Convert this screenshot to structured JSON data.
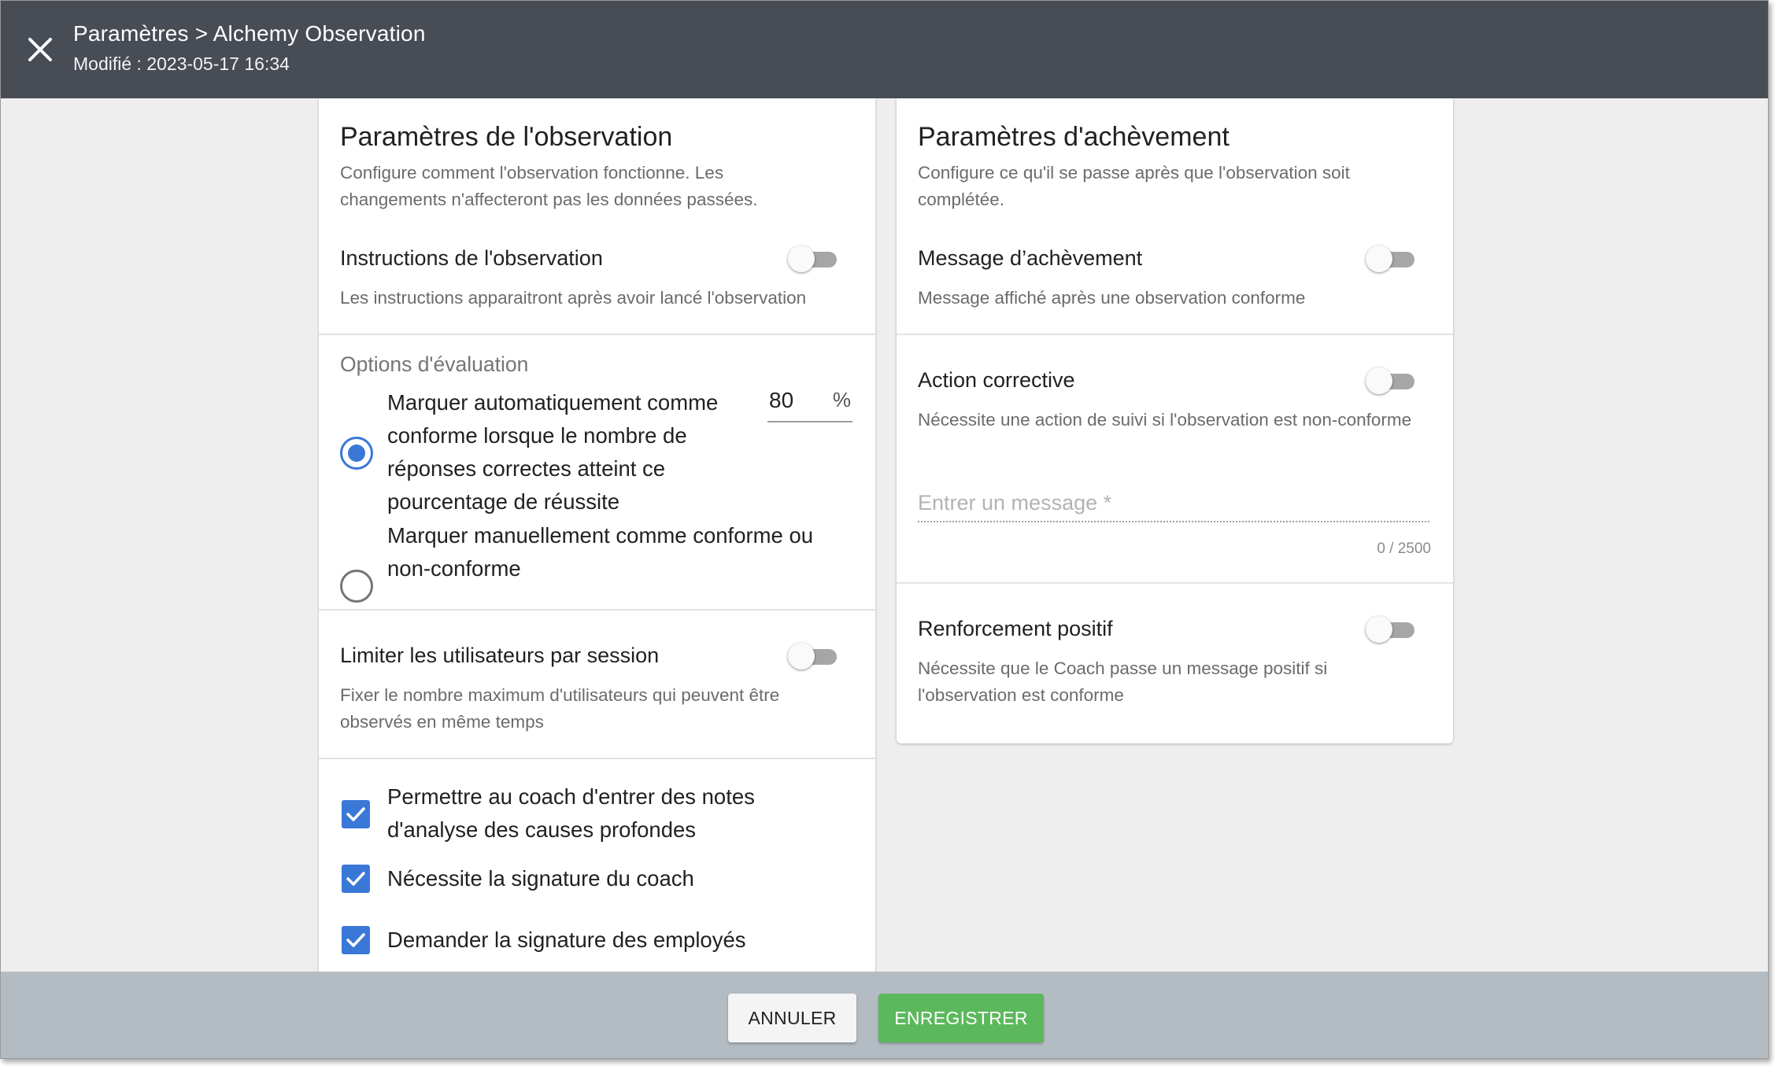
{
  "header": {
    "title": "Paramètres > Alchemy Observation",
    "modified": "Modifié : 2023-05-17 16:34"
  },
  "observation": {
    "title": "Paramètres de l'observation",
    "description": "Configure comment l'observation fonctionne. Les changements n'affecteront pas les données passées.",
    "instructions": {
      "label": "Instructions de l'observation",
      "description": "Les instructions apparaitront après avoir lancé l'observation",
      "enabled": false
    },
    "evaluation": {
      "title": "Options d'évaluation",
      "auto_label": "Marquer automatiquement comme conforme lorsque le nombre de réponses correctes atteint ce pourcentage de réussite",
      "manual_label": "Marquer manuellement comme conforme ou non-conforme",
      "threshold": "80",
      "unit": "%",
      "selected": "auto"
    },
    "limit_users": {
      "label": "Limiter les utilisateurs par session",
      "description": "Fixer le nombre maximum d'utilisateurs qui peuvent être observés en même temps",
      "enabled": false
    },
    "checkboxes": [
      {
        "label": "Permettre au coach d'entrer des notes d'analyse des causes profondes",
        "checked": true
      },
      {
        "label": "Nécessite la signature du coach",
        "checked": true
      },
      {
        "label": "Demander la signature des employés",
        "checked": true
      }
    ]
  },
  "completion": {
    "title": "Paramètres d'achèvement",
    "description": "Configure ce qu'il se passe après que l'observation soit complétée.",
    "message": {
      "label": "Message d’achèvement",
      "description": "Message affiché après une observation conforme",
      "enabled": false
    },
    "corrective": {
      "label": "Action corrective",
      "description": "Nécessite une action de suivi si l'observation est non-conforme",
      "enabled": false,
      "placeholder": "Entrer un message *",
      "counter": "0 / 2500"
    },
    "positive": {
      "label": "Renforcement positif",
      "description": "Nécessite que le Coach passe un message positif si l'observation est conforme",
      "enabled": false
    }
  },
  "footer": {
    "cancel_label": "ANNULER",
    "save_label": "ENREGISTRER"
  },
  "colors": {
    "header_bg": "#474c55",
    "accent": "#3a78d8",
    "save_button": "#5cb85c",
    "footer_bg": "#b4bcc3"
  }
}
